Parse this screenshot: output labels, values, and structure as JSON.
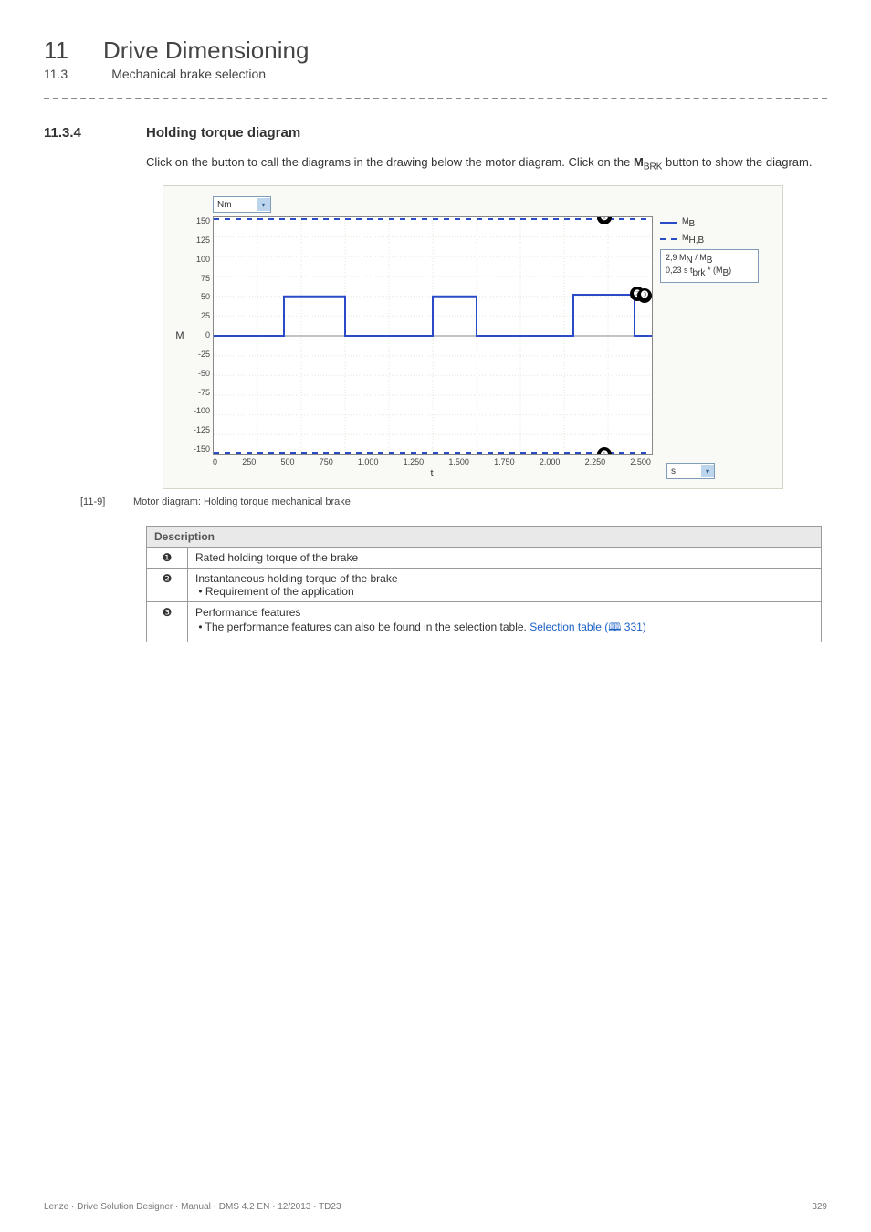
{
  "header": {
    "chapter_num": "11",
    "chapter_title": "Drive Dimensioning",
    "sub_num": "11.3",
    "sub_title": "Mechanical brake selection"
  },
  "section": {
    "num": "11.3.4",
    "title": "Holding torque diagram"
  },
  "body": {
    "para1_a": "Click on the button to call the diagrams in the drawing below the motor diagram. Click on the ",
    "para1_b": "M",
    "para1_sub": "BRK",
    "para1_c": " button to show the diagram."
  },
  "chart": {
    "y_unit_label": "Nm",
    "x_unit_label": "s",
    "y_title": "M",
    "x_title": "t",
    "legend": {
      "series_a": "M",
      "series_a_sub": "B",
      "series_b": "M",
      "series_b_sub": "H,B"
    },
    "info": {
      "line1_a": "2,9  M",
      "line1_sub1": "N",
      "line1_b": " / M",
      "line1_sub2": "B",
      "line2_a": "0,23 s  t",
      "line2_sub": "brk",
      "line2_b": " * (M",
      "line2_sub2": "B",
      "line2_c": ")"
    },
    "callouts": {
      "one": "❶",
      "two": "❷",
      "three": "❸"
    }
  },
  "fig_caption": {
    "tag": "[11-9]",
    "text": "Motor diagram: Holding torque mechanical brake"
  },
  "table": {
    "header": "Description",
    "rows": [
      {
        "mark": "❶",
        "text": "Rated holding torque of the brake"
      },
      {
        "mark": "❷",
        "text": "Instantaneous holding torque of the brake",
        "bullet": "Requirement of the application"
      },
      {
        "mark": "❸",
        "text": "Performance features",
        "bullet_a": "The performance features can also be found in the selection table. ",
        "link": "Selection table",
        "page_ref": " (🕮 331)"
      }
    ]
  },
  "footer": {
    "left": "Lenze · Drive Solution Designer · Manual · DMS 4.2 EN · 12/2013 · TD23",
    "right": "329"
  },
  "chart_data": {
    "type": "line",
    "x": [
      0,
      250,
      500,
      750,
      1000,
      1250,
      1500,
      1750,
      2000,
      2250,
      2500
    ],
    "xlim": [
      0,
      2500
    ],
    "ylim": [
      -150,
      150
    ],
    "y_ticks": [
      150,
      125,
      100,
      75,
      50,
      25,
      0,
      -25,
      -50,
      -75,
      -100,
      -125,
      -150
    ],
    "x_ticks": [
      0,
      250,
      500,
      750,
      "1.000",
      "1.250",
      "1.500",
      "1.750",
      "2.000",
      "2.250",
      "2.500"
    ],
    "series": [
      {
        "name": "M_B (rated holding torque)",
        "style": "blue-dashed",
        "type": "constant-band",
        "values": [
          150,
          -150
        ]
      },
      {
        "name": "M_H,B (instantaneous holding torque)",
        "style": "blue-step",
        "segments": [
          {
            "t": [
              0,
              400
            ],
            "v": 0
          },
          {
            "t": [
              400,
              750
            ],
            "v": 50
          },
          {
            "t": [
              750,
              1250
            ],
            "v": 0
          },
          {
            "t": [
              1250,
              1500
            ],
            "v": 50
          },
          {
            "t": [
              1500,
              2050
            ],
            "v": 0
          },
          {
            "t": [
              2050,
              2400
            ],
            "v": 52
          },
          {
            "t": [
              2400,
              2500
            ],
            "v": 0
          }
        ]
      }
    ]
  }
}
